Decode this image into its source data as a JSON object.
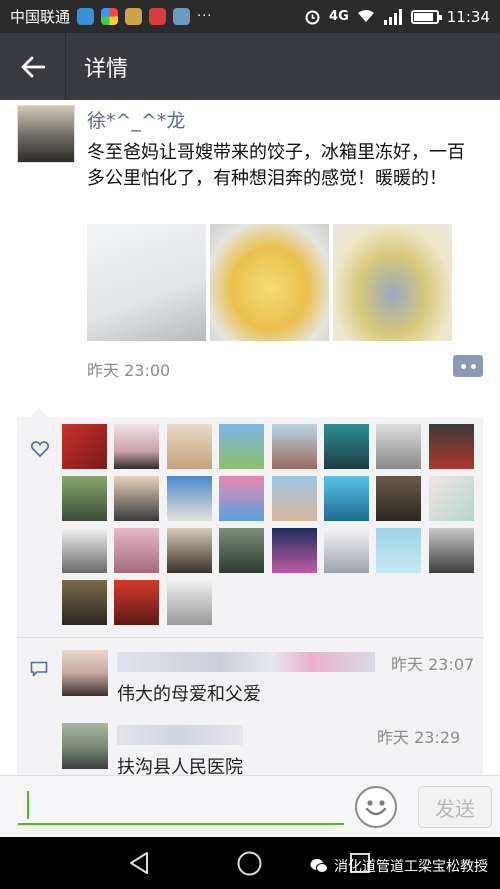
{
  "status_bar": {
    "carrier": "中国联通",
    "network": "4G",
    "network_small": "4G",
    "time": "11:34",
    "app_icons": [
      "app-icon-blue",
      "app-icon-multicolor",
      "app-icon-gold",
      "app-icon-red",
      "app-icon-gallery"
    ],
    "more": "···",
    "battery_level": 0.8
  },
  "header": {
    "title": "详情",
    "accent": "#393a3f"
  },
  "post": {
    "username": "徐*^_^*龙",
    "text": "冬至爸妈让哥嫂带来的饺子，冰箱里冻好，一百多公里怕化了，有种想泪奔的感觉！暖暖的！",
    "photos": [
      "styrofoam-box",
      "dumplings-yellow-cloth",
      "dumplings-bag"
    ],
    "time": "昨天 23:00"
  },
  "likes": {
    "icon": "heart-icon",
    "count": 27
  },
  "comments": [
    {
      "name_blurred": true,
      "time": "昨天 23:07",
      "text": "伟大的母爱和父爱"
    },
    {
      "name_blurred": true,
      "time": "昨天 23:29",
      "text": "扶沟县人民医院"
    }
  ],
  "input": {
    "placeholder": "",
    "value": "",
    "send_label": "发送"
  },
  "watermark": {
    "text": "消化道管道工梁宝松教授"
  },
  "colors": {
    "link": "#576b95",
    "green": "#45c01a",
    "meta": "#8c8c8c"
  }
}
